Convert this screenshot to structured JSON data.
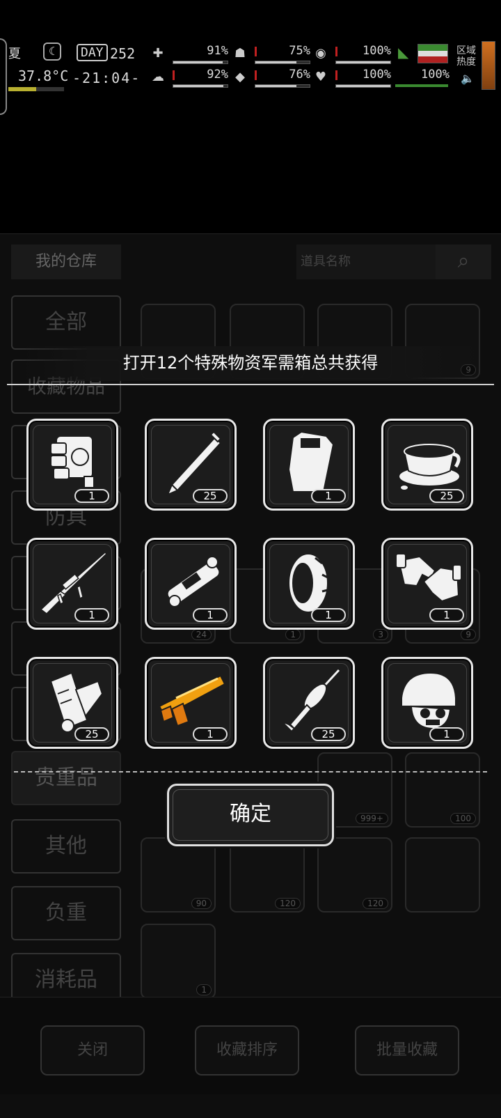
{
  "hud": {
    "season": "夏",
    "temperature": "37.8°C",
    "day_label": "DAY",
    "day_number": "252",
    "clock": "-21:04-",
    "stats": [
      {
        "icon": "medkit-icon",
        "glyph": "✚",
        "value": "91%"
      },
      {
        "icon": "stomach-icon",
        "glyph": "☗",
        "value": "75%"
      },
      {
        "icon": "stamina-icon",
        "glyph": "◉",
        "value": "100%"
      },
      {
        "icon": "brain-icon",
        "glyph": "☁",
        "value": "92%"
      },
      {
        "icon": "water-drop-icon",
        "glyph": "💧",
        "value": "76%"
      },
      {
        "icon": "heart-icon",
        "glyph": "♥",
        "value": "100%"
      },
      {
        "icon": "battery-icon",
        "glyph": "",
        "value": "100%"
      }
    ],
    "region_label": "区域\n热度",
    "temp_fill": 0.5
  },
  "warehouse": {
    "title": "我的仓库",
    "search_placeholder": "道具名称",
    "categories": [
      "全部",
      "收藏物品",
      "防具",
      "贵重品",
      "其他",
      "负重",
      "消耗品"
    ],
    "bottom_buttons": [
      "关闭",
      "收藏排序",
      "批量收藏"
    ],
    "background_counts": [
      "9",
      "24",
      "1",
      "3",
      "9",
      "999+",
      "100",
      "90",
      "120",
      "120",
      "1"
    ]
  },
  "reward": {
    "title": "打开12个特殊物资军需箱总共获得",
    "items": [
      {
        "name": "engine-block",
        "qty": "1"
      },
      {
        "name": "pen",
        "qty": "25"
      },
      {
        "name": "riot-shield",
        "qty": "1"
      },
      {
        "name": "coffee-cup",
        "qty": "25"
      },
      {
        "name": "sniper-rifle",
        "qty": "1"
      },
      {
        "name": "rocket-launcher-part",
        "qty": "1"
      },
      {
        "name": "tire",
        "qty": "1"
      },
      {
        "name": "handshake",
        "qty": "1"
      },
      {
        "name": "paper-scroll",
        "qty": "25"
      },
      {
        "name": "orange-shotgun",
        "qty": "1"
      },
      {
        "name": "rpg-rocket",
        "qty": "25"
      },
      {
        "name": "tactical-helmet",
        "qty": "1"
      }
    ],
    "confirm_label": "确定"
  },
  "colors": {
    "background": "#000000",
    "panel_border": "#e8e8e8",
    "accent_orange": "#f0a010",
    "temp_bar": "#b8b030",
    "health_red": "#c02020"
  }
}
